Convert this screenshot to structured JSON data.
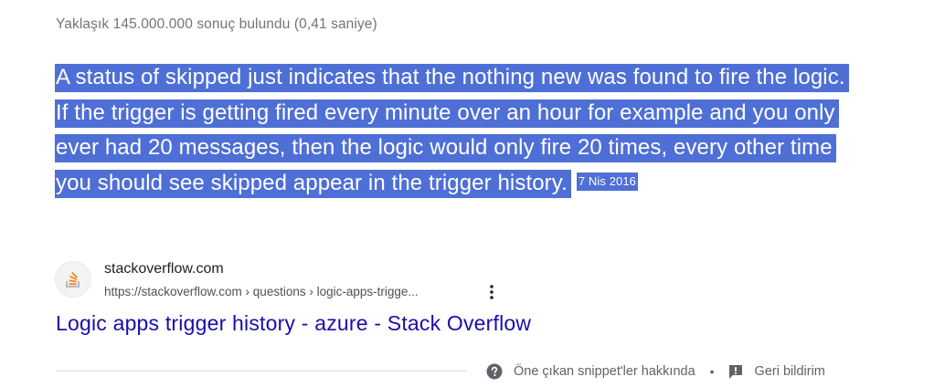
{
  "result_stats": "Yaklaşık 145.000.000 sonuç bulundu (0,41 saniye)",
  "featured_snippet": {
    "text": "A status of skipped just indicates that the nothing new was found to fire the logic. If the trigger is getting fired every minute over an hour for example and you only ever had 20 messages, then the logic would only fire 20 times, every other time you should see skipped appear in the trigger history.",
    "date": "7 Nis 2016",
    "highlight_color": "#4e6fd6"
  },
  "source": {
    "favicon": "stackoverflow-icon",
    "site_name": "stackoverflow.com",
    "url": "https://stackoverflow.com › questions › logic-apps-trigge...",
    "menu_icon": "more-vert-icon"
  },
  "result_title": "Logic apps trigger history - azure - Stack Overflow",
  "footer": {
    "about_icon": "help-circle-icon",
    "about_label": "Öne çıkan snippet'ler hakkında",
    "separator": "•",
    "feedback_icon": "feedback-icon",
    "feedback_label": "Geri bildirim"
  },
  "colors": {
    "link": "#1a0dab",
    "secondary_text": "#70757a",
    "url_text": "#4d5156"
  }
}
